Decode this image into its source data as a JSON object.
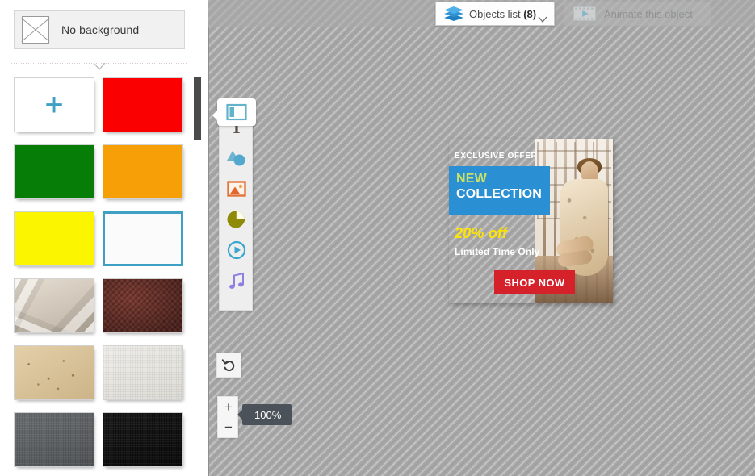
{
  "left_panel": {
    "no_background": {
      "label": "No background",
      "icon": "no-background-x-icon"
    },
    "add_swatch_glyph": "+",
    "swatches": [
      {
        "name": "add-background",
        "type": "add",
        "color": "#ffffff",
        "selected": false
      },
      {
        "name": "red",
        "type": "color",
        "color": "#fa0000",
        "selected": false
      },
      {
        "name": "green",
        "type": "color",
        "color": "#067d06",
        "selected": false
      },
      {
        "name": "orange",
        "type": "color",
        "color": "#f79f07",
        "selected": false
      },
      {
        "name": "yellow",
        "type": "color",
        "color": "#fcf500",
        "selected": false
      },
      {
        "name": "white",
        "type": "color",
        "color": "#fbfbfb",
        "selected": true
      },
      {
        "name": "crumpled-paper",
        "type": "texture",
        "texture": "tex-crumpled",
        "selected": false
      },
      {
        "name": "brown-leather",
        "type": "texture",
        "texture": "tex-leather",
        "selected": false
      },
      {
        "name": "kraft-paper",
        "type": "texture",
        "texture": "tex-kraft",
        "selected": false
      },
      {
        "name": "white-canvas",
        "type": "texture",
        "texture": "tex-canvas",
        "selected": false
      },
      {
        "name": "gray-cloth",
        "type": "texture",
        "texture": "tex-graycloth",
        "selected": false
      },
      {
        "name": "black-cloth",
        "type": "texture",
        "texture": "tex-blackcloth",
        "selected": false
      }
    ]
  },
  "topbar": {
    "objects_list": {
      "label": "Objects list ",
      "count": "(8)",
      "icon": "layers-icon",
      "chevron": "chevron-down-icon"
    },
    "animate": {
      "label": "Animate this object",
      "icon": "film-play-icon",
      "disabled": true
    }
  },
  "tool_dock": {
    "active_tab": {
      "name": "background-tool",
      "icon": "background-layout-icon"
    },
    "tools": [
      {
        "name": "text-tool",
        "icon": "text-T-icon",
        "glyph": "T"
      },
      {
        "name": "shapes-tool",
        "icon": "shapes-icon"
      },
      {
        "name": "image-tool",
        "icon": "image-icon"
      },
      {
        "name": "chart-tool",
        "icon": "pie-chart-icon"
      },
      {
        "name": "video-tool",
        "icon": "video-play-icon"
      },
      {
        "name": "audio-tool",
        "icon": "music-note-icon"
      }
    ]
  },
  "canvas_controls": {
    "undo": {
      "label": "undo",
      "icon": "undo-arrow-icon"
    },
    "zoom_in": "+",
    "zoom_out": "−",
    "zoom_level": "100%"
  },
  "banner": {
    "exclusive_offer": "EXCLUSIVE OFFER",
    "new": "NEW",
    "collection": "COLLECTION",
    "discount": "20% off",
    "limited": "Limited Time Only",
    "shop_now": "SHOP NOW",
    "photo_alt": "woman-in-floral-dress-by-window",
    "colors": {
      "band": "#2b8fd4",
      "new_text": "#c9e265",
      "discount_text": "#ffe400",
      "button": "#d4212a"
    }
  }
}
